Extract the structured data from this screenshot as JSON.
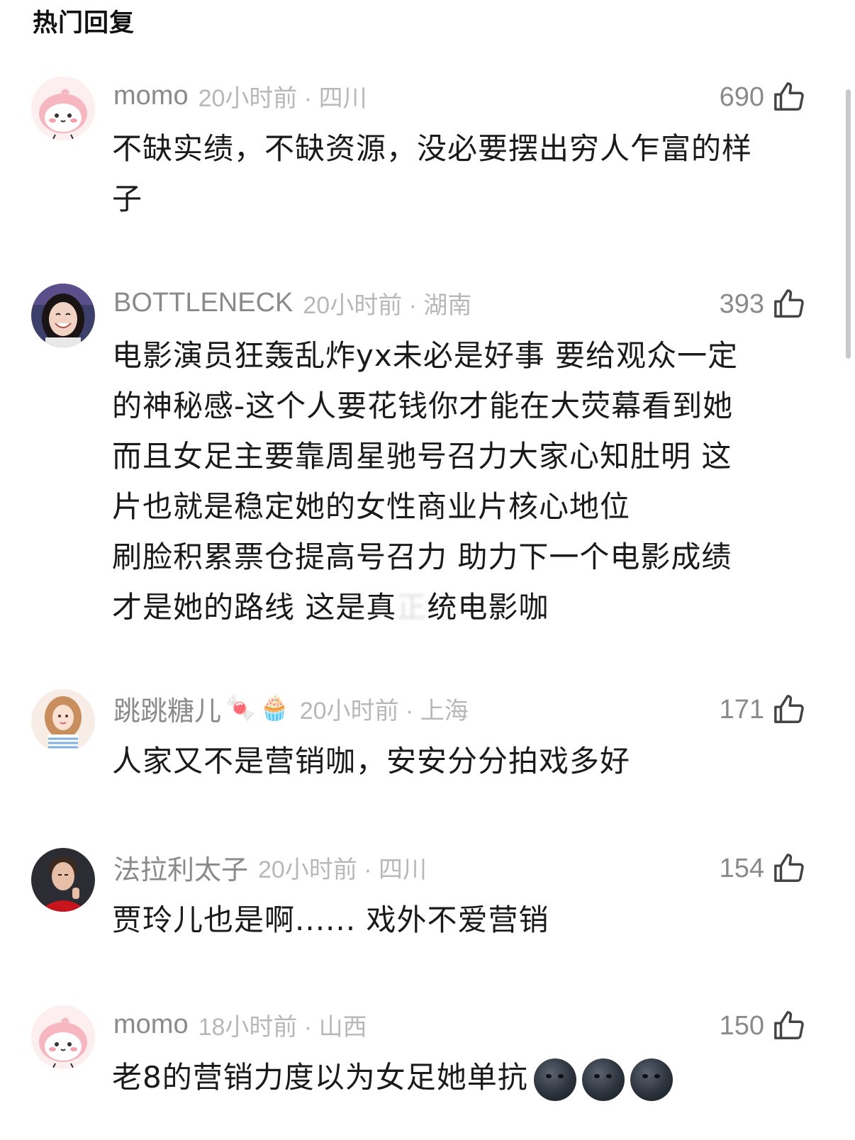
{
  "header": {
    "title": "热门回复"
  },
  "colors": {
    "username": "#8a8a8a",
    "meta": "#b8b8b8",
    "text": "#1a1a1a"
  },
  "comments": [
    {
      "username": "momo",
      "time_location": "20小时前 · 四川",
      "likes": "690",
      "avatar_icon": "pink-blob-avatar",
      "lines": [
        "不缺实绩，不缺资源，没必要摆出穷人乍富的样",
        "子"
      ]
    },
    {
      "username": "BOTTLENECK",
      "time_location": "20小时前 · 湖南",
      "likes": "393",
      "avatar_icon": "smiling-girl-photo-avatar",
      "lines": [
        "电影演员狂轰乱炸yx未必是好事 要给观众一定",
        "的神秘感-这个人要花钱你才能在大荧幕看到她",
        "而且女足主要靠周星驰号召力大家心知肚明 这",
        "片也就是稳定她的女性商业片核心地位",
        "刷脸积累票仓提高号召力 助力下一个电影成绩",
        "才是她的路线 这是真",
        "正",
        "统电影咖"
      ]
    },
    {
      "username": "跳跳糖儿",
      "badges": [
        "🍬",
        "🧁"
      ],
      "time_location": "20小时前 · 上海",
      "likes": "171",
      "avatar_icon": "illustrated-girl-avatar",
      "lines": [
        "人家又不是营销咖，安安分分拍戏多好"
      ]
    },
    {
      "username": "法拉利太子",
      "time_location": "20小时前 · 四川",
      "likes": "154",
      "avatar_icon": "man-in-red-photo-avatar",
      "lines": [
        "贾玲儿也是啊...... 戏外不爱营销"
      ]
    },
    {
      "username": "momo",
      "time_location": "18小时前 · 山西",
      "likes": "150",
      "avatar_icon": "pink-blob-avatar",
      "lines": [
        "老8的营销力度以为女足她单抗"
      ],
      "trailing_emoji": "new-moon-face-emoji"
    }
  ]
}
